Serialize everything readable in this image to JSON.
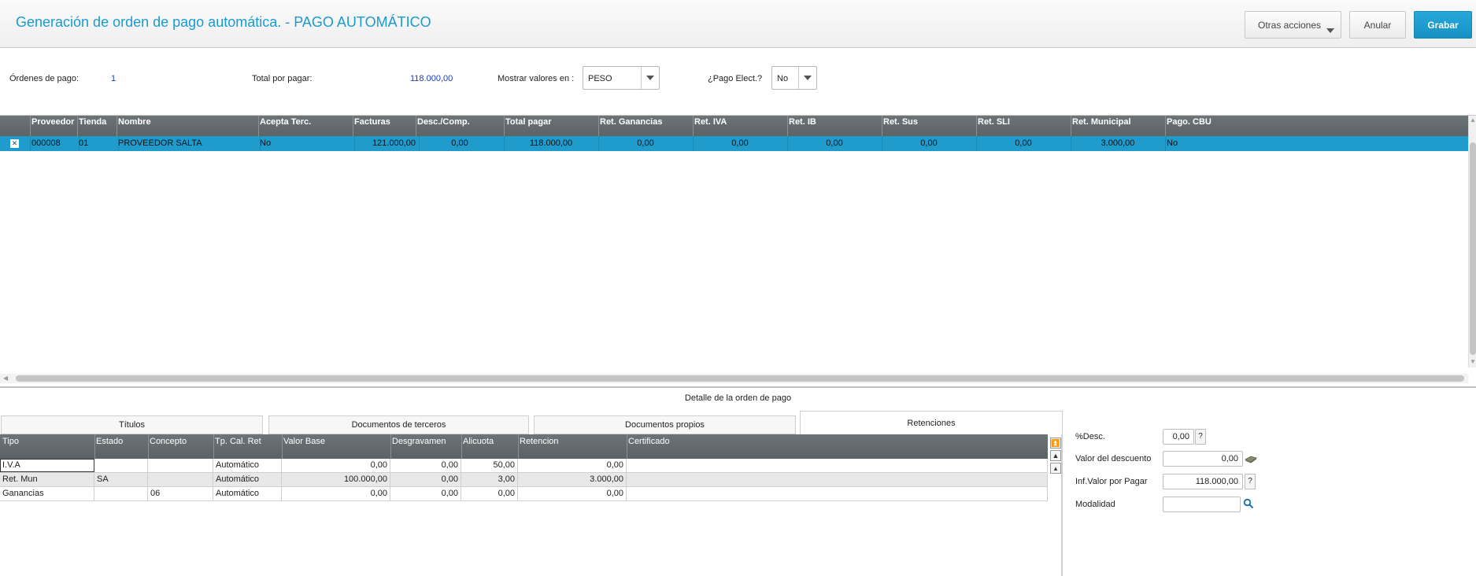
{
  "header": {
    "title": "Generación de orden de pago automática. - PAGO AUTOMÁTICO",
    "otras_acciones": "Otras acciones",
    "anular": "Anular",
    "grabar": "Grabar"
  },
  "summary": {
    "ordenes_label": "Órdenes de pago:",
    "ordenes_value": "1",
    "total_label": "Total por pagar:",
    "total_value": "118.000,00",
    "mostrar_label": "Mostrar valores en :",
    "mostrar_value": "PESO",
    "pago_elect_label": "¿Pago Elect.?",
    "pago_elect_value": "No"
  },
  "grid1": {
    "headers": [
      "Proveedor",
      "Tienda",
      "Nombre",
      "Acepta Terc.",
      "Facturas",
      "Desc./Comp.",
      "Total pagar",
      "Ret. Ganancias",
      "Ret. IVA",
      "Ret. IB",
      "Ret. Sus",
      "Ret. SLI",
      "Ret. Municipal",
      "Pago. CBU"
    ],
    "rows": [
      [
        "000008",
        "01",
        "PROVEEDOR SALTA",
        "No",
        "121.000,00",
        "0,00",
        "118.000,00",
        "0,00",
        "0,00",
        "0,00",
        "0,00",
        "0,00",
        "3.000,00",
        "No"
      ]
    ]
  },
  "detail": {
    "title": "Detalle de la orden de pago",
    "tabs": [
      "Títulos",
      "Documentos de terceros",
      "Documentos propios",
      "Retenciones"
    ],
    "headers": [
      "Tipo",
      "Estado",
      "Concepto",
      "Tp. Cal. Ret",
      "Valor Base",
      "Desgravamen",
      "Alicuota",
      "Retencion",
      "Certificado"
    ],
    "rows": [
      [
        "I.V.A",
        "",
        "",
        "Automático",
        "0,00",
        "0,00",
        "50,00",
        "0,00",
        ""
      ],
      [
        "Ret. Mun",
        "SA",
        "",
        "Automático",
        "100.000,00",
        "0,00",
        "3,00",
        "3.000,00",
        ""
      ],
      [
        "Ganancias",
        "",
        "06",
        "Automático",
        "0,00",
        "0,00",
        "0,00",
        "0,00",
        ""
      ]
    ]
  },
  "panel": {
    "desc_pct_label": "%Desc.",
    "desc_pct_value": "0,00",
    "valor_desc_label": "Valor del descuento",
    "valor_desc_value": "0,00",
    "inf_valor_label": "Inf.Valor por Pagar",
    "inf_valor_value": "118.000,00",
    "modalidad_label": "Modalidad",
    "modalidad_value": "",
    "question_mark": "?"
  },
  "colors": {
    "accent": "#1a9bd0",
    "selected_row": "#1f9bcc",
    "grid_header": "#62696d",
    "primary_button": "#1f9bcc"
  }
}
